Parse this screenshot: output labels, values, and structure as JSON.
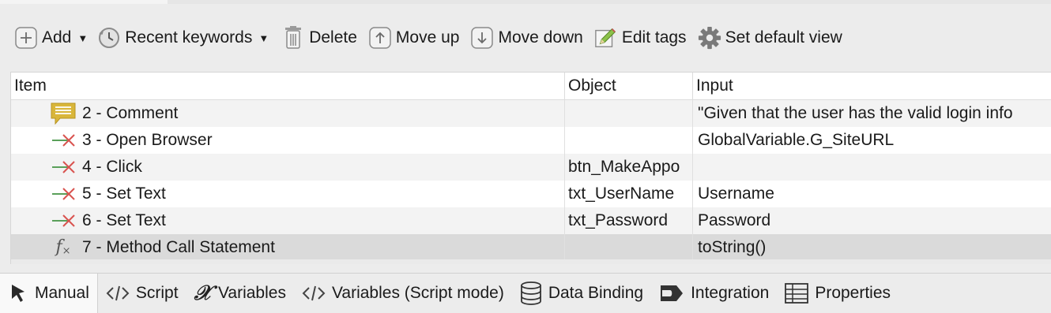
{
  "toolbar": {
    "add": "Add",
    "recent_keywords": "Recent keywords",
    "delete": "Delete",
    "move_up": "Move up",
    "move_down": "Move down",
    "edit_tags": "Edit tags",
    "set_default_view": "Set default view"
  },
  "table": {
    "columns": [
      "Item",
      "Object",
      "Input"
    ],
    "rows": [
      {
        "icon": "comment-icon",
        "item": "2 - Comment",
        "object": "",
        "input": "\"Given that the user has the valid login info"
      },
      {
        "icon": "keyword-arrow-icon",
        "item": "3 - Open Browser",
        "object": "",
        "input": "GlobalVariable.G_SiteURL"
      },
      {
        "icon": "keyword-arrow-icon",
        "item": "4 - Click",
        "object": "btn_MakeAppo",
        "input": ""
      },
      {
        "icon": "keyword-arrow-icon",
        "item": "5 - Set Text",
        "object": "txt_UserName",
        "input": "Username"
      },
      {
        "icon": "keyword-arrow-icon",
        "item": "6 - Set Text",
        "object": "txt_Password",
        "input": "Password"
      },
      {
        "icon": "function-icon",
        "item": "7 - Method Call Statement",
        "object": "",
        "input": "toString()"
      }
    ]
  },
  "tabs": {
    "manual": "Manual",
    "script": "Script",
    "variables": "Variables",
    "variables_script": "Variables (Script mode)",
    "data_binding": "Data Binding",
    "integration": "Integration",
    "properties": "Properties"
  },
  "colors": {
    "comment_icon": "#d9b63a",
    "arrow_green": "#5aa05a",
    "cross_red": "#d9534f",
    "selected_row": "#dadada"
  }
}
